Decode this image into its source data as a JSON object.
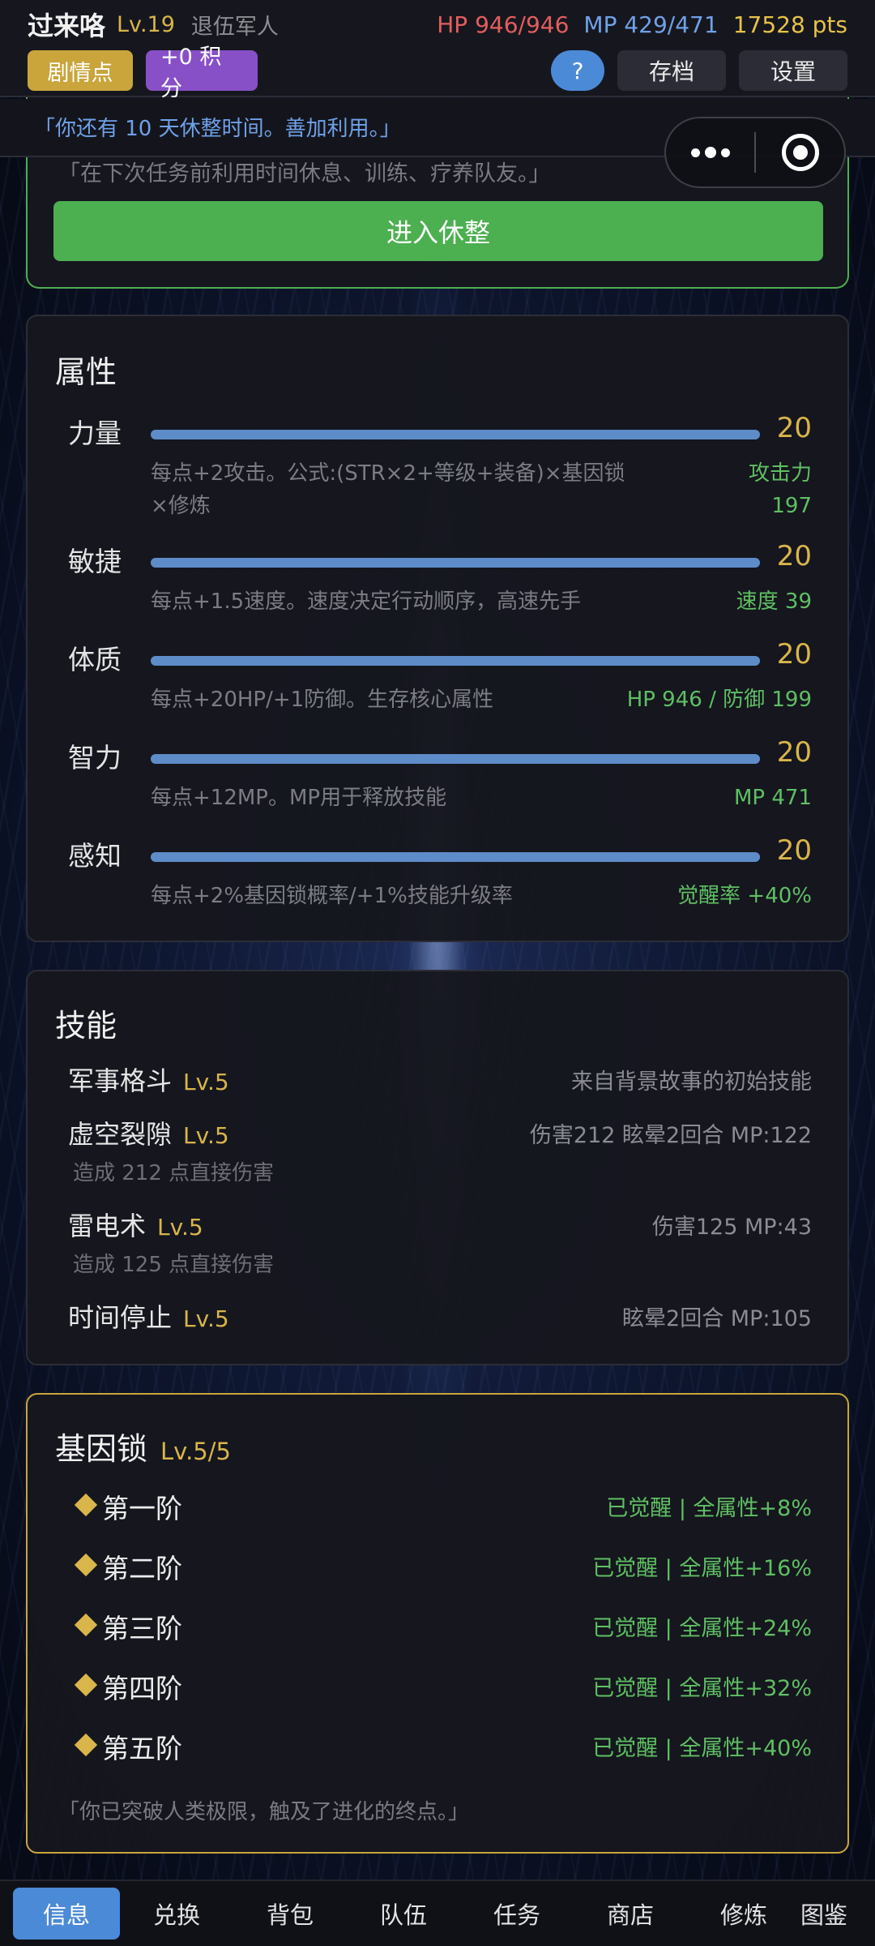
{
  "player": {
    "name": "过来咯",
    "level": "Lv.19",
    "class": "退伍军人",
    "hp": "HP 946/946",
    "mp": "MP 429/471",
    "points": "17528 pts"
  },
  "toolbar": {
    "plot_label": "剧情点",
    "score_label": "+0 积分",
    "help_label": "?",
    "save_label": "存档",
    "settings_label": "设置"
  },
  "notice": "「你还有 10 天休整时间。善加利用。」",
  "capsule": {
    "more_icon": "more-dots-icon",
    "close_icon": "target-circle-icon"
  },
  "rest": {
    "quote": "「在下次任务前利用时间休息、训练、疗养队友。」",
    "button_label": "进入休整"
  },
  "attributes": {
    "title": "属性",
    "items": [
      {
        "name": "力量",
        "value": "20",
        "fill": 1.0,
        "desc": "每点+2攻击。公式:(STR×2+等级+装备)×基因锁×修炼",
        "effect_label": "攻击力",
        "effect_value": "197"
      },
      {
        "name": "敏捷",
        "value": "20",
        "fill": 1.0,
        "desc": "每点+1.5速度。速度决定行动顺序，高速先手",
        "effect": "速度 39"
      },
      {
        "name": "体质",
        "value": "20",
        "fill": 1.0,
        "desc": "每点+20HP/+1防御。生存核心属性",
        "effect": "HP 946 / 防御 199"
      },
      {
        "name": "智力",
        "value": "20",
        "fill": 1.0,
        "desc": "每点+12MP。MP用于释放技能",
        "effect": "MP 471"
      },
      {
        "name": "感知",
        "value": "20",
        "fill": 1.0,
        "desc": "每点+2%基因锁概率/+1%技能升级率",
        "effect": "觉醒率 +40%"
      }
    ]
  },
  "skills": {
    "title": "技能",
    "items": [
      {
        "name": "军事格斗",
        "level": "Lv.5",
        "info": "来自背景故事的初始技能",
        "sub": ""
      },
      {
        "name": "虚空裂隙",
        "level": "Lv.5",
        "info": "伤害212 眩晕2回合 MP:122",
        "sub": "造成 212 点直接伤害"
      },
      {
        "name": "雷电术",
        "level": "Lv.5",
        "info": "伤害125 MP:43",
        "sub": "造成 125 点直接伤害"
      },
      {
        "name": "时间停止",
        "level": "Lv.5",
        "info": "眩晕2回合 MP:105",
        "sub": ""
      }
    ]
  },
  "gene_lock": {
    "title": "基因锁",
    "level": "Lv.5/5",
    "tiers": [
      {
        "name": "第一阶",
        "status": "已觉醒 | 全属性+8%"
      },
      {
        "name": "第二阶",
        "status": "已觉醒 | 全属性+16%"
      },
      {
        "name": "第三阶",
        "status": "已觉醒 | 全属性+24%"
      },
      {
        "name": "第四阶",
        "status": "已觉醒 | 全属性+32%"
      },
      {
        "name": "第五阶",
        "status": "已觉醒 | 全属性+40%"
      }
    ],
    "quote": "「你已突破人类极限，触及了进化的终点。」"
  },
  "nav": {
    "items": [
      "信息",
      "兑换",
      "背包",
      "队伍",
      "任务",
      "商店",
      "修炼",
      "图鉴"
    ],
    "active": "信息"
  },
  "colors": {
    "accent_blue": "#4b8ad6",
    "gold": "#d9b54a",
    "green": "#4caf50",
    "hp_red": "#e35d5d",
    "mp_blue": "#6fa1e8",
    "purple": "#8850c7"
  }
}
